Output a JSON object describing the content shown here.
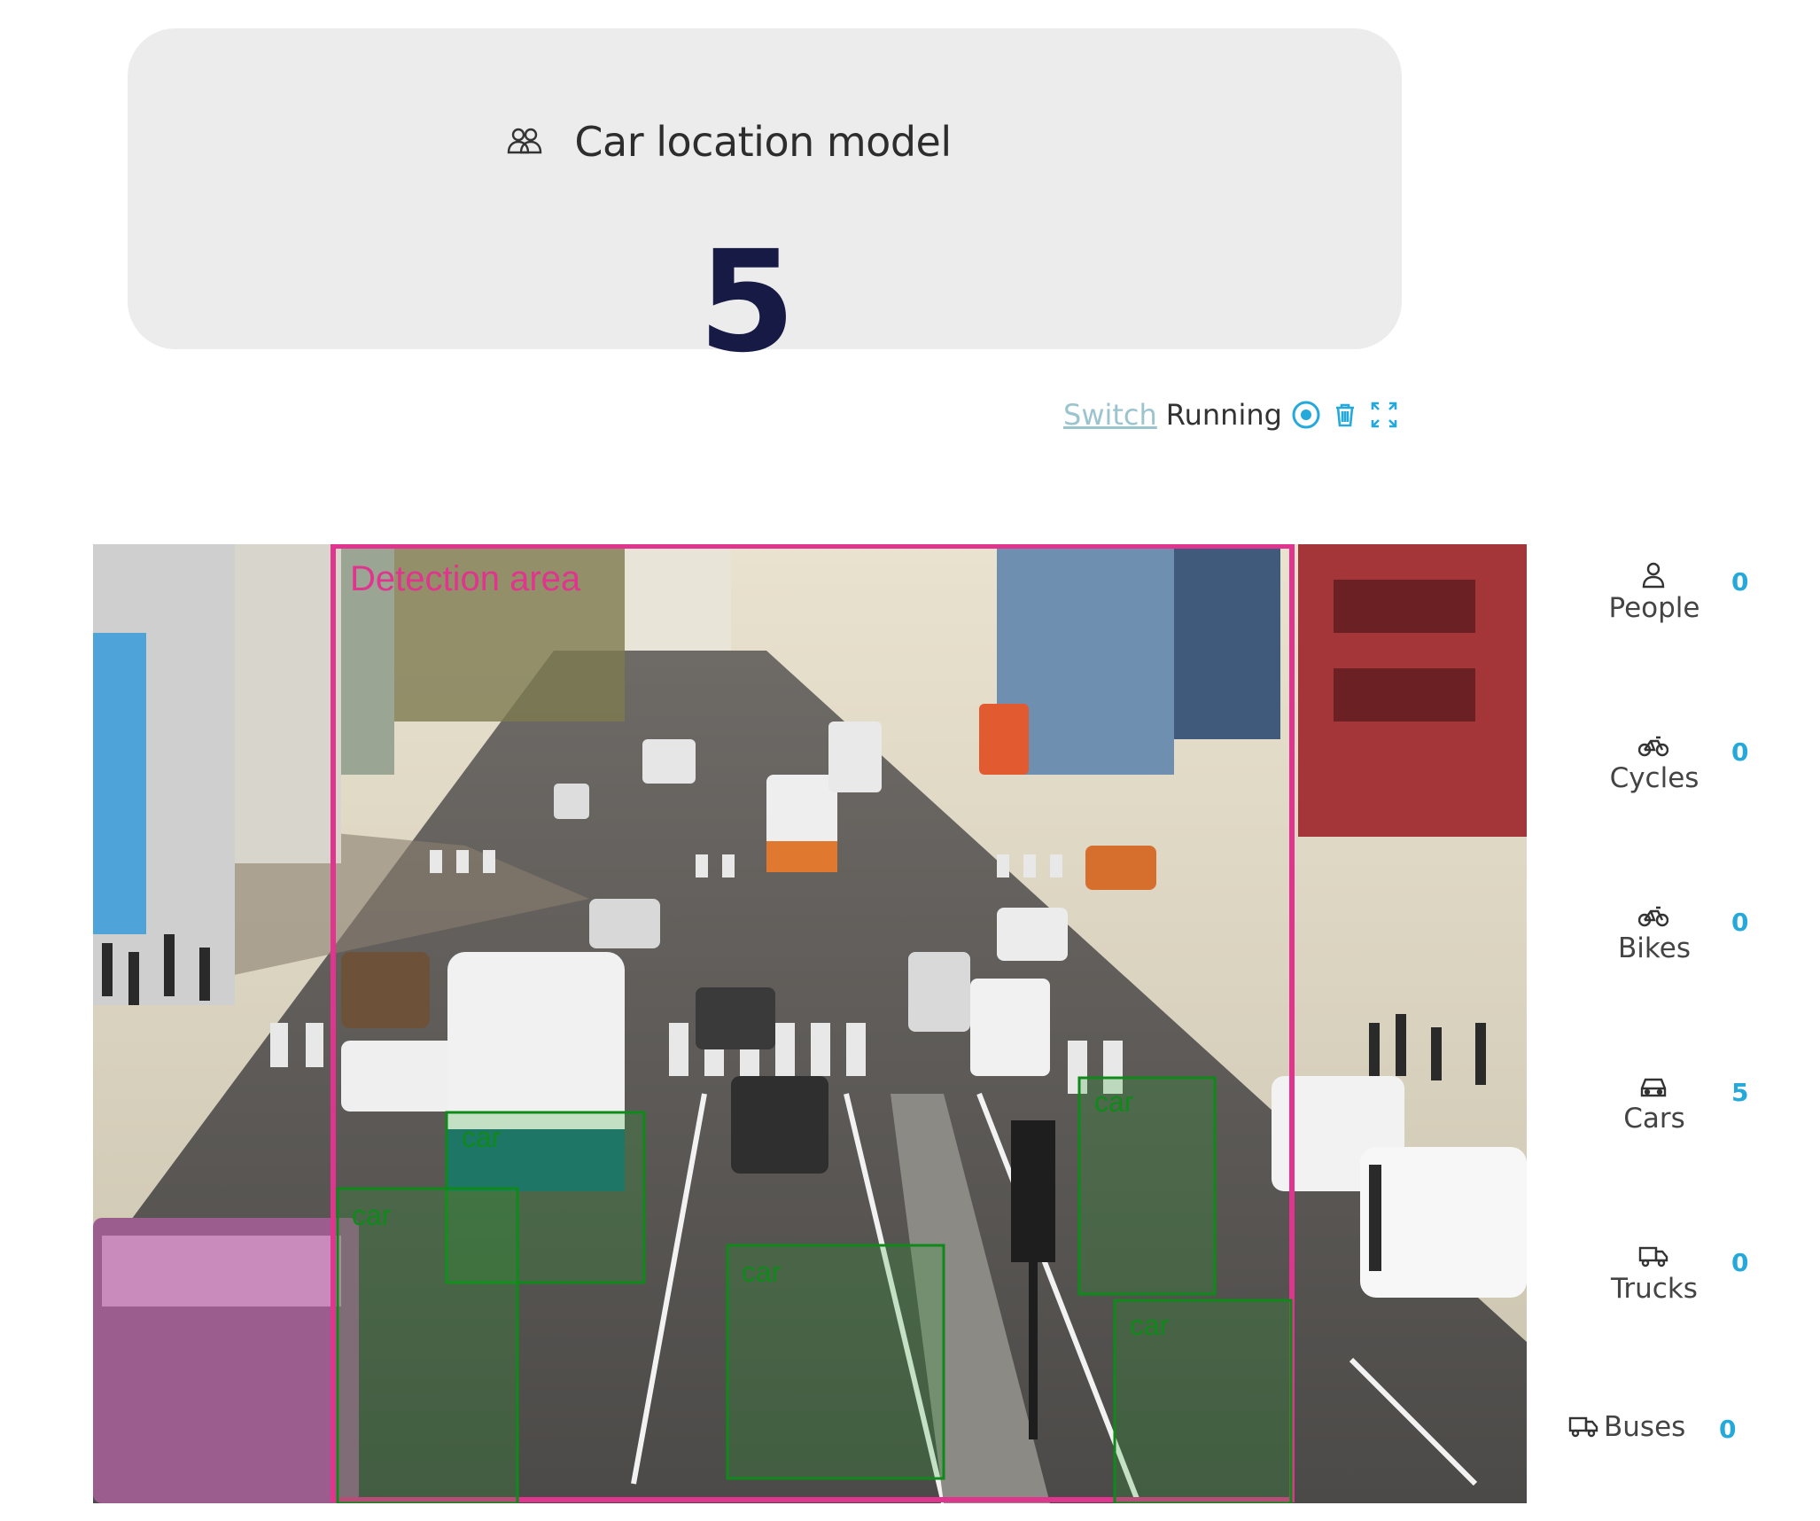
{
  "model": {
    "title": "Car location model",
    "count": "5",
    "icon": "people-group-icon"
  },
  "controls": {
    "switch_label": "Switch",
    "status_label": "Running",
    "icons": [
      "record-icon",
      "trash-icon",
      "fullscreen-icon"
    ],
    "accent_color": "#25a9da"
  },
  "camera": {
    "detection_area_label": "Detection area",
    "detection_area_color": "#e0348e",
    "box_color": "#0f8a1a",
    "detections": [
      {
        "label": "car"
      },
      {
        "label": "car"
      },
      {
        "label": "car"
      },
      {
        "label": "car"
      },
      {
        "label": "car"
      }
    ]
  },
  "stats": [
    {
      "label": "People",
      "value": "0",
      "icon": "person-icon"
    },
    {
      "label": "Cycles",
      "value": "0",
      "icon": "bicycle-icon"
    },
    {
      "label": "Bikes",
      "value": "0",
      "icon": "bicycle-icon"
    },
    {
      "label": "Cars",
      "value": "5",
      "icon": "car-icon"
    },
    {
      "label": "Trucks",
      "value": "0",
      "icon": "truck-icon"
    },
    {
      "label": "Buses",
      "value": "0",
      "icon": "truck-icon"
    }
  ]
}
